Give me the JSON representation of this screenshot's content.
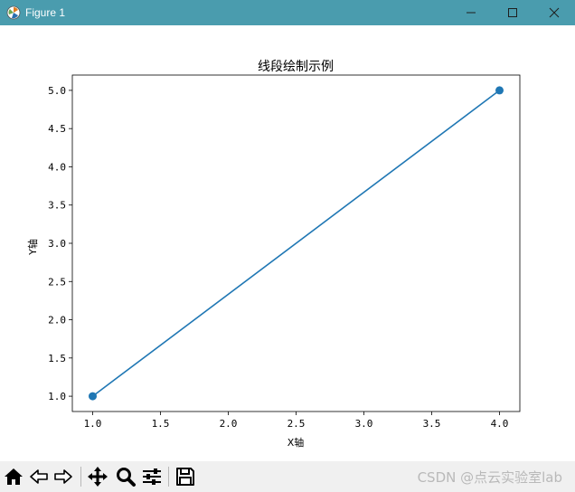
{
  "window": {
    "title": "Figure 1",
    "controls": [
      "minimize",
      "maximize",
      "close"
    ]
  },
  "toolbar": {
    "buttons": [
      {
        "name": "home",
        "icon": "home-icon"
      },
      {
        "name": "back",
        "icon": "back-arrow-icon"
      },
      {
        "name": "forward",
        "icon": "forward-arrow-icon"
      },
      {
        "name": "pan",
        "icon": "move-icon"
      },
      {
        "name": "zoom",
        "icon": "zoom-icon"
      },
      {
        "name": "configure-subplots",
        "icon": "sliders-icon"
      },
      {
        "name": "save",
        "icon": "save-icon"
      }
    ],
    "watermark": "CSDN @点云实验室lab"
  },
  "chart_data": {
    "type": "line",
    "title": "线段绘制示例",
    "xlabel": "X轴",
    "ylabel": "Y轴",
    "series": [
      {
        "x": [
          1,
          4
        ],
        "y": [
          1,
          5
        ],
        "color": "#1f77b4",
        "marker": "o"
      }
    ],
    "xlim": [
      0.85,
      4.15
    ],
    "ylim": [
      0.8,
      5.2
    ],
    "xticks": [
      1.0,
      1.5,
      2.0,
      2.5,
      3.0,
      3.5,
      4.0
    ],
    "xtick_labels": [
      "1.0",
      "1.5",
      "2.0",
      "2.5",
      "3.0",
      "3.5",
      "4.0"
    ],
    "yticks": [
      1.0,
      1.5,
      2.0,
      2.5,
      3.0,
      3.5,
      4.0,
      4.5,
      5.0
    ],
    "ytick_labels": [
      "1.0",
      "1.5",
      "2.0",
      "2.5",
      "3.0",
      "3.5",
      "4.0",
      "4.5",
      "5.0"
    ],
    "grid": false,
    "legend": "none"
  }
}
